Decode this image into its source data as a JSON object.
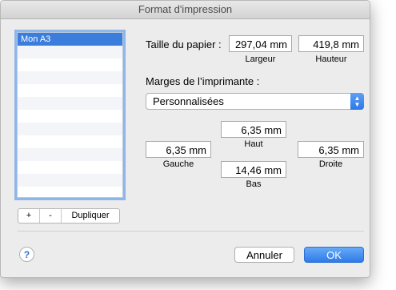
{
  "window": {
    "title": "Format d'impression"
  },
  "sizes_list": {
    "items": [
      "Mon A3"
    ],
    "selected_index": 0
  },
  "list_buttons": {
    "add": "+",
    "remove": "-",
    "duplicate": "Dupliquer"
  },
  "paper": {
    "label": "Taille du papier :",
    "width_value": "297,04 mm",
    "width_label": "Largeur",
    "height_value": "419,8 mm",
    "height_label": "Hauteur"
  },
  "margins": {
    "label": "Marges de l’imprimante :",
    "preset": "Personnalisées",
    "top_value": "6,35 mm",
    "top_label": "Haut",
    "left_value": "6,35 mm",
    "left_label": "Gauche",
    "right_value": "6,35 mm",
    "right_label": "Droite",
    "bottom_value": "14,46 mm",
    "bottom_label": "Bas"
  },
  "footer": {
    "help": "?",
    "cancel": "Annuler",
    "ok": "OK"
  },
  "colors": {
    "accent": "#2f7ae8",
    "selection": "#3b7ddd"
  }
}
